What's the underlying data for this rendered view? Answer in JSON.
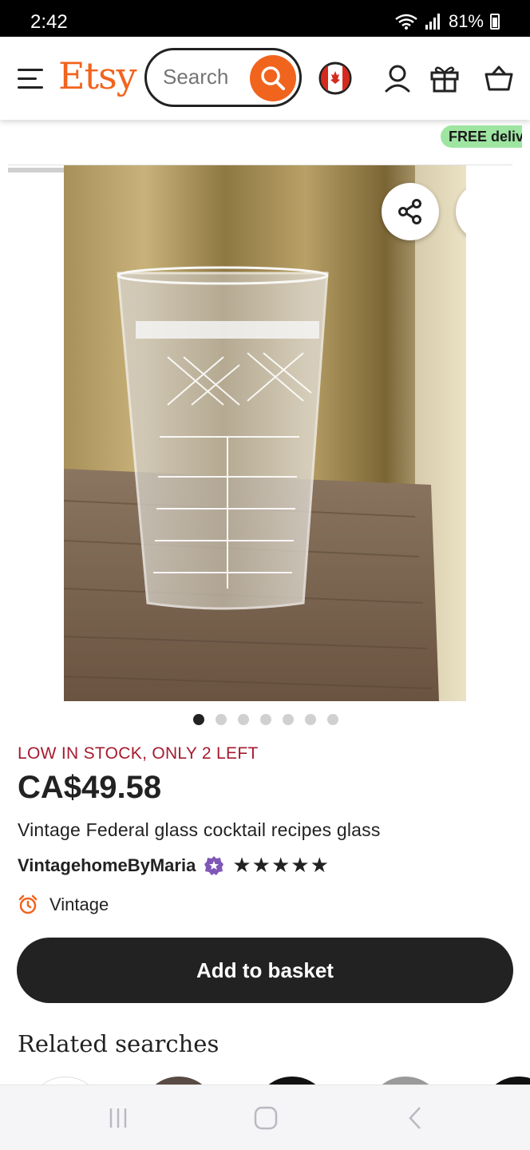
{
  "status_bar": {
    "time": "2:42",
    "network": "6E",
    "battery": "81%"
  },
  "header": {
    "logo": "Etsy",
    "search_placeholder": "Search",
    "icons": [
      "menu-icon",
      "search-icon",
      "canada-flag-icon",
      "account-icon",
      "gift-icon",
      "basket-icon"
    ]
  },
  "banner": {
    "free_delivery": "FREE deliv"
  },
  "gallery": {
    "image_count": 7,
    "active_index": 0
  },
  "product": {
    "stock": "LOW IN STOCK, ONLY 2 LEFT",
    "price": "CA$49.58",
    "title": "Vintage Federal glass cocktail recipes glass",
    "seller": "VintagehomeByMaria",
    "rating_stars": "★★★★★",
    "rating": 5,
    "category": "Vintage"
  },
  "actions": {
    "add_to_basket": "Add to basket"
  },
  "related": {
    "heading": "Related searches"
  },
  "colors": {
    "brand_orange": "#F1641E",
    "stock_red": "#A61A2E",
    "free_green": "#9EE5A1",
    "star_seller_purple": "#7F58B7"
  }
}
